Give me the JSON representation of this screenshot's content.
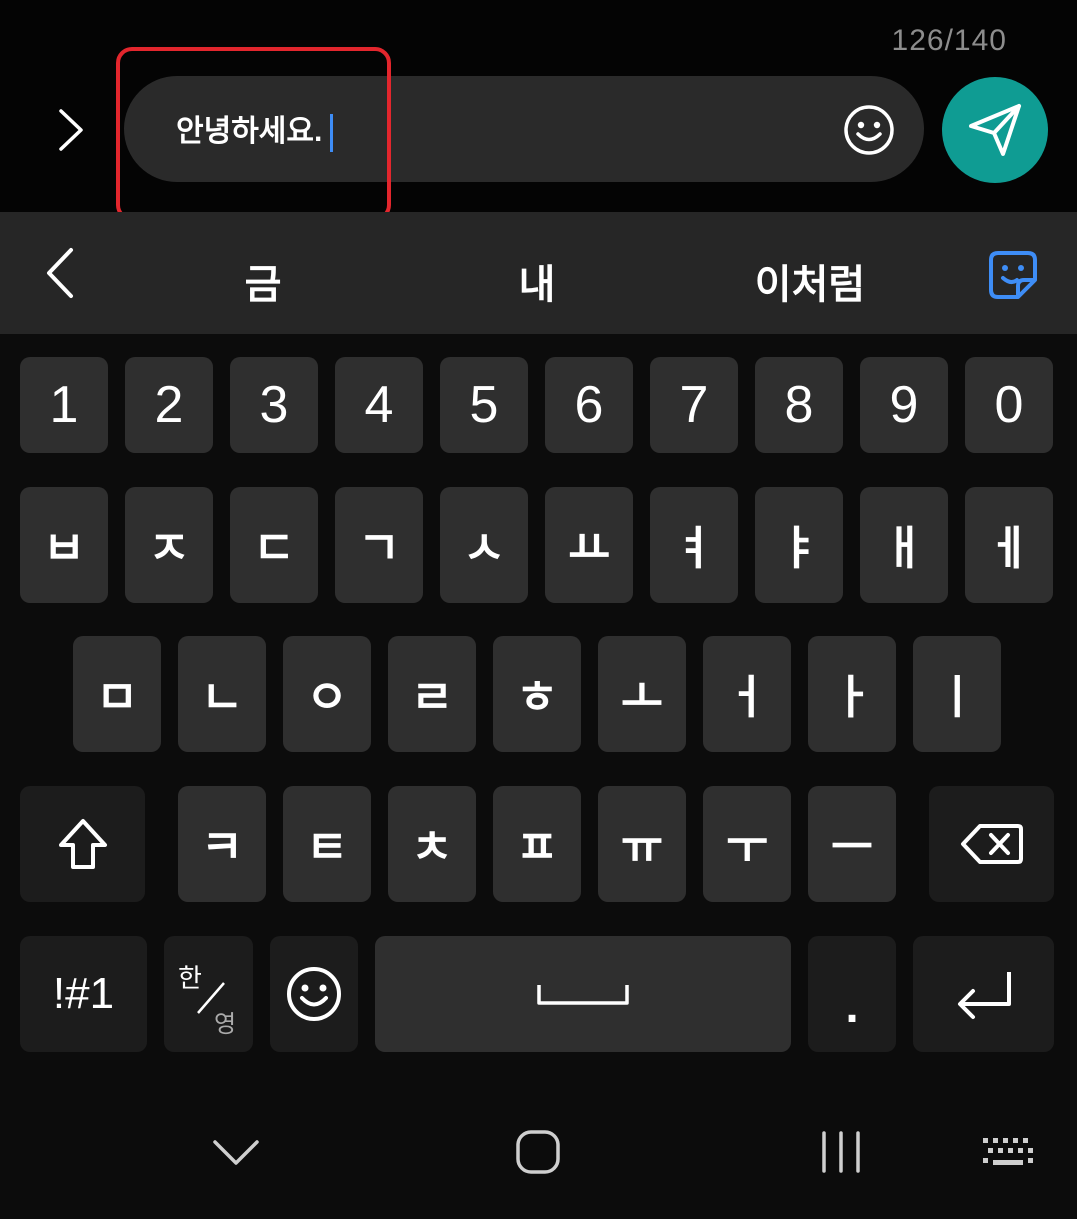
{
  "compose": {
    "char_counter": "126/140",
    "message_text": "안녕하세요.",
    "icons": {
      "expand": "chevron-right-icon",
      "emoji": "smiley-icon",
      "send": "paper-plane-icon"
    },
    "send_color": "#0f9c93",
    "highlight_color": "#e3262d"
  },
  "suggestions": {
    "words": [
      "금",
      "내",
      "이처럼"
    ],
    "icons": {
      "back": "chevron-left-icon",
      "sticker": "sticker-icon"
    },
    "sticker_color": "#3e8df6"
  },
  "keyboard": {
    "numbers": [
      "1",
      "2",
      "3",
      "4",
      "5",
      "6",
      "7",
      "8",
      "9",
      "0"
    ],
    "row1": [
      "ㅂ",
      "ㅈ",
      "ㄷ",
      "ㄱ",
      "ㅅ",
      "ㅛ",
      "ㅕ",
      "ㅑ",
      "ㅐ",
      "ㅔ"
    ],
    "row2": [
      "ㅁ",
      "ㄴ",
      "ㅇ",
      "ㄹ",
      "ㅎ",
      "ㅗ",
      "ㅓ",
      "ㅏ",
      "ㅣ"
    ],
    "row3": [
      "ㅋ",
      "ㅌ",
      "ㅊ",
      "ㅍ",
      "ㅠ",
      "ㅜ",
      "ㅡ"
    ],
    "symbols_key": "!#1",
    "lang_key_top": "한",
    "lang_key_bottom": "영",
    "period_key": ".",
    "icons": {
      "shift": "shift-icon",
      "backspace": "backspace-icon",
      "emoji": "smiley-icon",
      "space": "space-icon",
      "enter": "enter-icon"
    }
  },
  "navbar": {
    "icons": [
      "chevron-down-icon",
      "home-icon",
      "recents-icon",
      "keyboard-icon"
    ]
  }
}
